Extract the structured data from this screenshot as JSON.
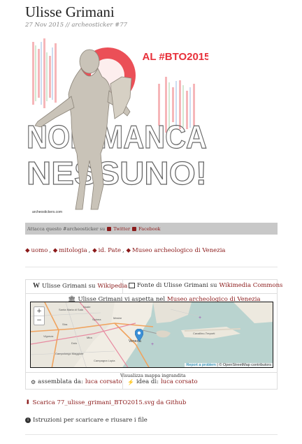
{
  "post": {
    "title": "Ulisse Grimani",
    "date": "27 Nov 2015",
    "separator": "//",
    "category": "archeosticker #77"
  },
  "sticker": {
    "banner": "AL #BTO2015",
    "line1": "NON MANCA",
    "line2": "NESSUNO!",
    "credit": "archeostickers.com",
    "accent_color": "#e8303a"
  },
  "share": {
    "prefix": "Attacca questo #archeosticker su",
    "twitter": "Twitter",
    "facebook": "Facebook"
  },
  "tags": [
    "uomo",
    "mitologia",
    "id. Pate",
    "Museo archeologico di Venezia"
  ],
  "links": {
    "wikipedia_prefix": "Ulisse Grimani su",
    "wikipedia": "Wikipedia",
    "commons_prefix": "Fonte di Ulisse Grimani su",
    "commons": "Wikimedia Commons",
    "museum_prefix": "Ulisse Grimani vi aspetta nel",
    "museum": "Museo archeologico di Venezia"
  },
  "map": {
    "zoom_in": "+",
    "zoom_out": "−",
    "places": [
      "Santa Maria di Sala",
      "Noale",
      "Spinea",
      "Mestre",
      "Vigonza",
      "Mira",
      "Venezia",
      "Cavallino-Treporti",
      "Campagna Lupia",
      "Campolongo Maggiore",
      "Dolo",
      "Stra"
    ],
    "report": "Report a problem",
    "attribution": "© OpenStreetMap contributors",
    "enlarge": "Visualizza mappa ingrandita"
  },
  "credits": {
    "assembled_label": "assemblata da:",
    "assembled_by": "luca corsato",
    "idea_label": "idea di:",
    "idea_by": "luca corsato"
  },
  "download": {
    "label": "Scarica 77_ulisse_grimani_BTO2015.svg da Github"
  },
  "instructions": {
    "label": "Istruzioni per scaricare e riusare i file"
  }
}
